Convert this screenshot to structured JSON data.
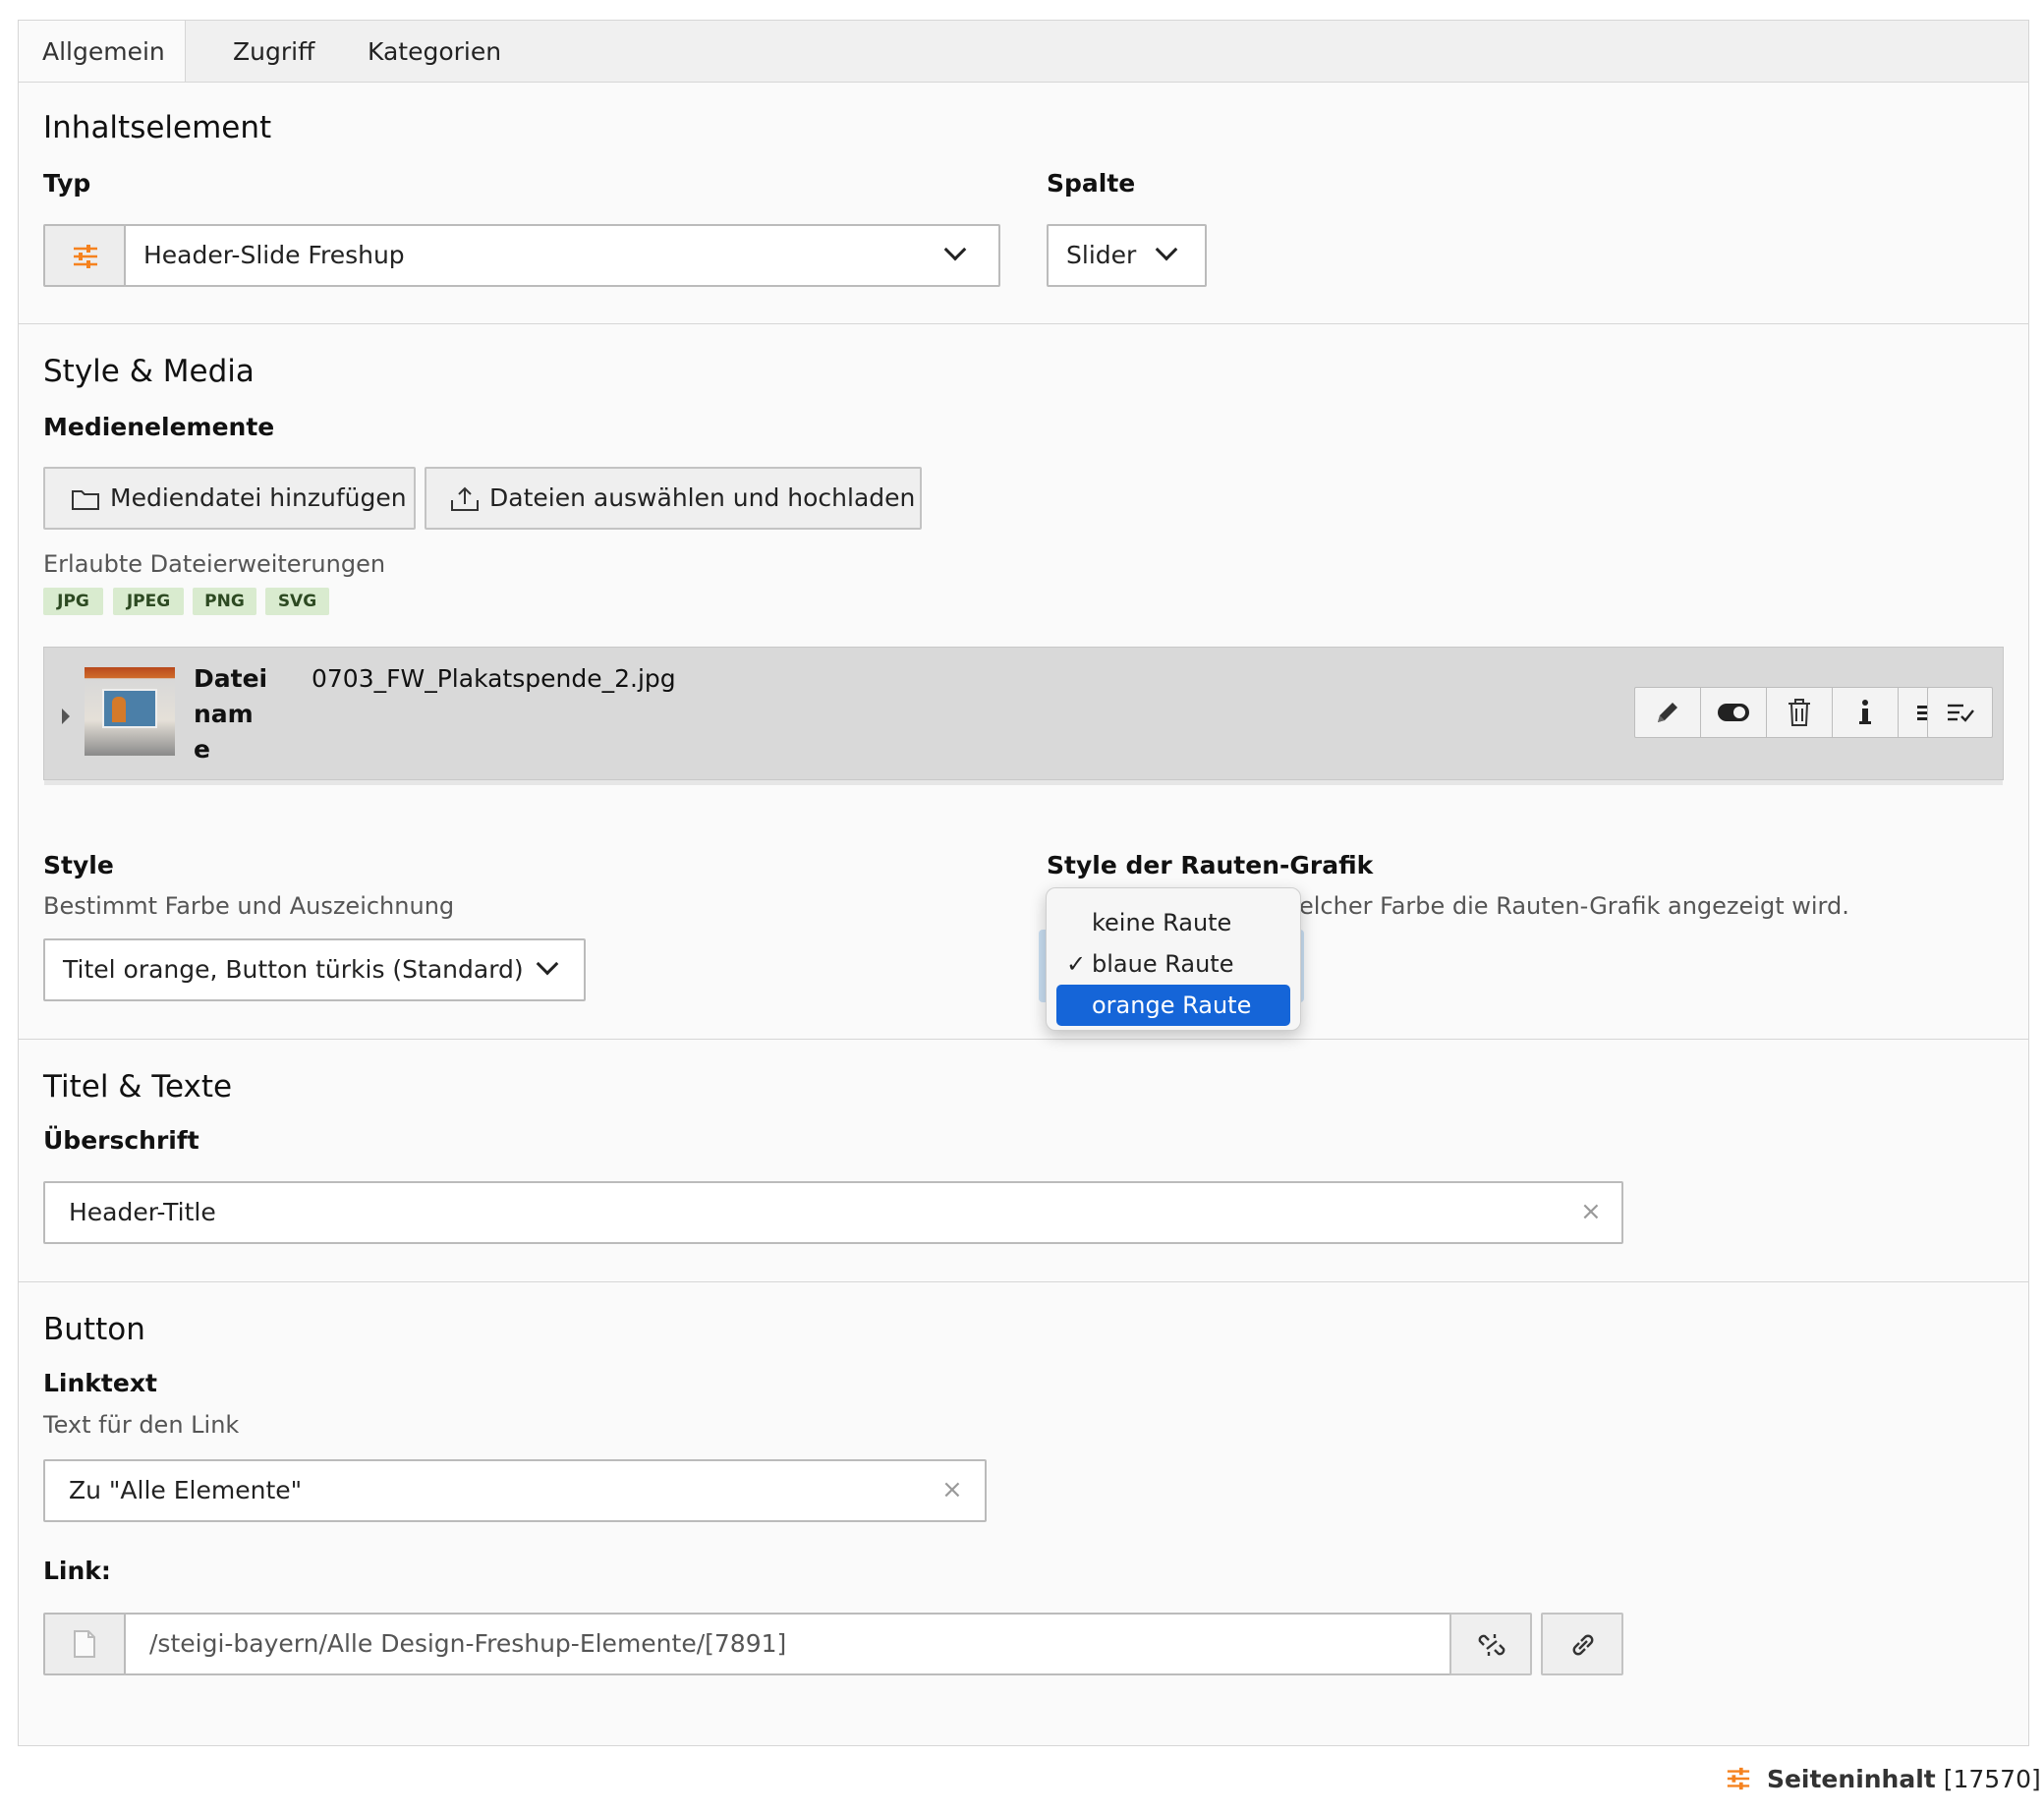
{
  "tabs": [
    {
      "label": "Allgemein",
      "active": true
    },
    {
      "label": "Zugriff",
      "active": false
    },
    {
      "label": "Kategorien",
      "active": false
    }
  ],
  "inhaltselement": {
    "heading": "Inhaltselement",
    "typ_label": "Typ",
    "typ_value": "Header-Slide Freshup",
    "spalte_label": "Spalte",
    "spalte_value": "Slider"
  },
  "style_media": {
    "heading": "Style & Media",
    "medien_label": "Medienelemente",
    "add_media_button": "Mediendatei hinzufügen",
    "upload_button": "Dateien auswählen und hochladen",
    "allowed_label": "Erlaubte Dateierweiterungen",
    "extensions": [
      "JPG",
      "JPEG",
      "PNG",
      "SVG"
    ],
    "file": {
      "name_label_lines": [
        "Datei",
        "nam",
        "e"
      ],
      "name_value": "0703_FW_Plakatspende_2.jpg"
    },
    "style_label": "Style",
    "style_desc": "Bestimmt Farbe und Auszeichnung",
    "style_value": "Titel orange, Button türkis (Standard)",
    "rauten_label": "Style der Rauten-Grafik",
    "rauten_desc_visible": "elcher Farbe die Rauten-Grafik angezeigt wird.",
    "rauten_options": [
      {
        "label": "keine Raute",
        "checked": false,
        "highlighted": false
      },
      {
        "label": "blaue Raute",
        "checked": true,
        "highlighted": false
      },
      {
        "label": "orange Raute",
        "checked": false,
        "highlighted": true
      }
    ]
  },
  "titel_texte": {
    "heading": "Titel & Texte",
    "ueberschrift_label": "Überschrift",
    "ueberschrift_value": "Header-Title"
  },
  "button": {
    "heading": "Button",
    "linktext_label": "Linktext",
    "linktext_desc": "Text für den Link",
    "linktext_value": "Zu \"Alle Elemente\"",
    "link_label": "Link:",
    "link_value": "/steigi-bayern/Alle Design-Freshup-Elemente/[7891]"
  },
  "footer": {
    "title": "Seiteninhalt",
    "id": "[17570]"
  },
  "colors": {
    "accent_orange": "#f5821f",
    "highlight_blue": "#1565d8",
    "badge_green": "#d9ebcf"
  }
}
